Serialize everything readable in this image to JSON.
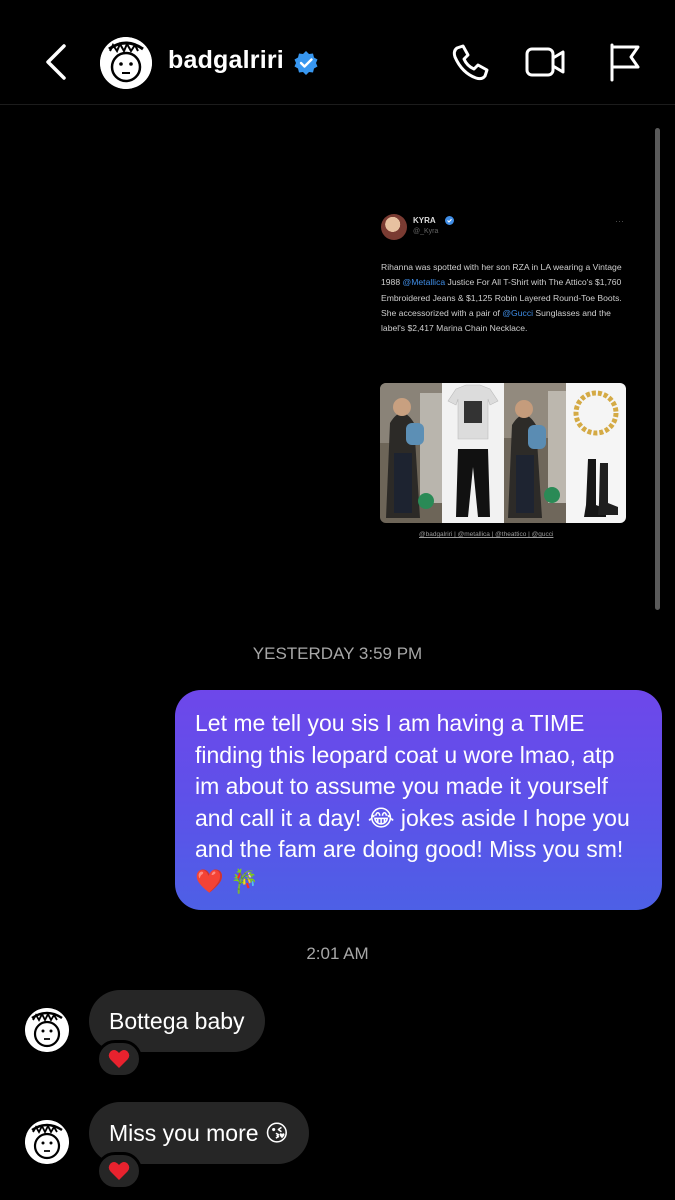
{
  "header": {
    "username": "badgalriri",
    "verified_color": "#3897f0",
    "icons": [
      "back-chevron-icon",
      "phone-icon",
      "video-camera-icon",
      "flag-icon"
    ]
  },
  "shared_post": {
    "author_name": "KYRA",
    "author_handle": "@_Kyra",
    "text_parts": [
      "Rihanna was spotted with her son RZA in LA wearing a Vintage 1988 ",
      "@Metallica",
      " Justice For All T-Shirt with The Attico's $1,760 Embroidered Jeans & $1,125 Robin Layered Round-Toe Boots. She accessorized with a pair of ",
      "@Gucci",
      " Sunglasses and the label's  $2,417 Marina Chain Necklace."
    ],
    "caption": "@badgalriri | @metallica | @theattico | @gucci"
  },
  "timestamps": {
    "first": "YESTERDAY 3:59 PM",
    "second": "2:01 AM"
  },
  "messages": {
    "sent_1": "Let me tell you sis I am having a TIME finding this leopard coat u wore lmao, atp im about to assume you made it yourself and call it a day! 😂 jokes aside I hope you and the fam are doing good! Miss you sm! ❤️ 🎋",
    "received_1": "Bottega baby",
    "received_2": "Miss you more 😘",
    "reaction_1": "❤️",
    "reaction_2": "❤️"
  },
  "colors": {
    "background": "#000000",
    "sent_bubble_top": "#6e47ea",
    "sent_bubble_bottom": "#4d60e6",
    "received_bubble": "#262626",
    "timestamp": "#a7a7a7",
    "mention": "#3f8de6"
  }
}
